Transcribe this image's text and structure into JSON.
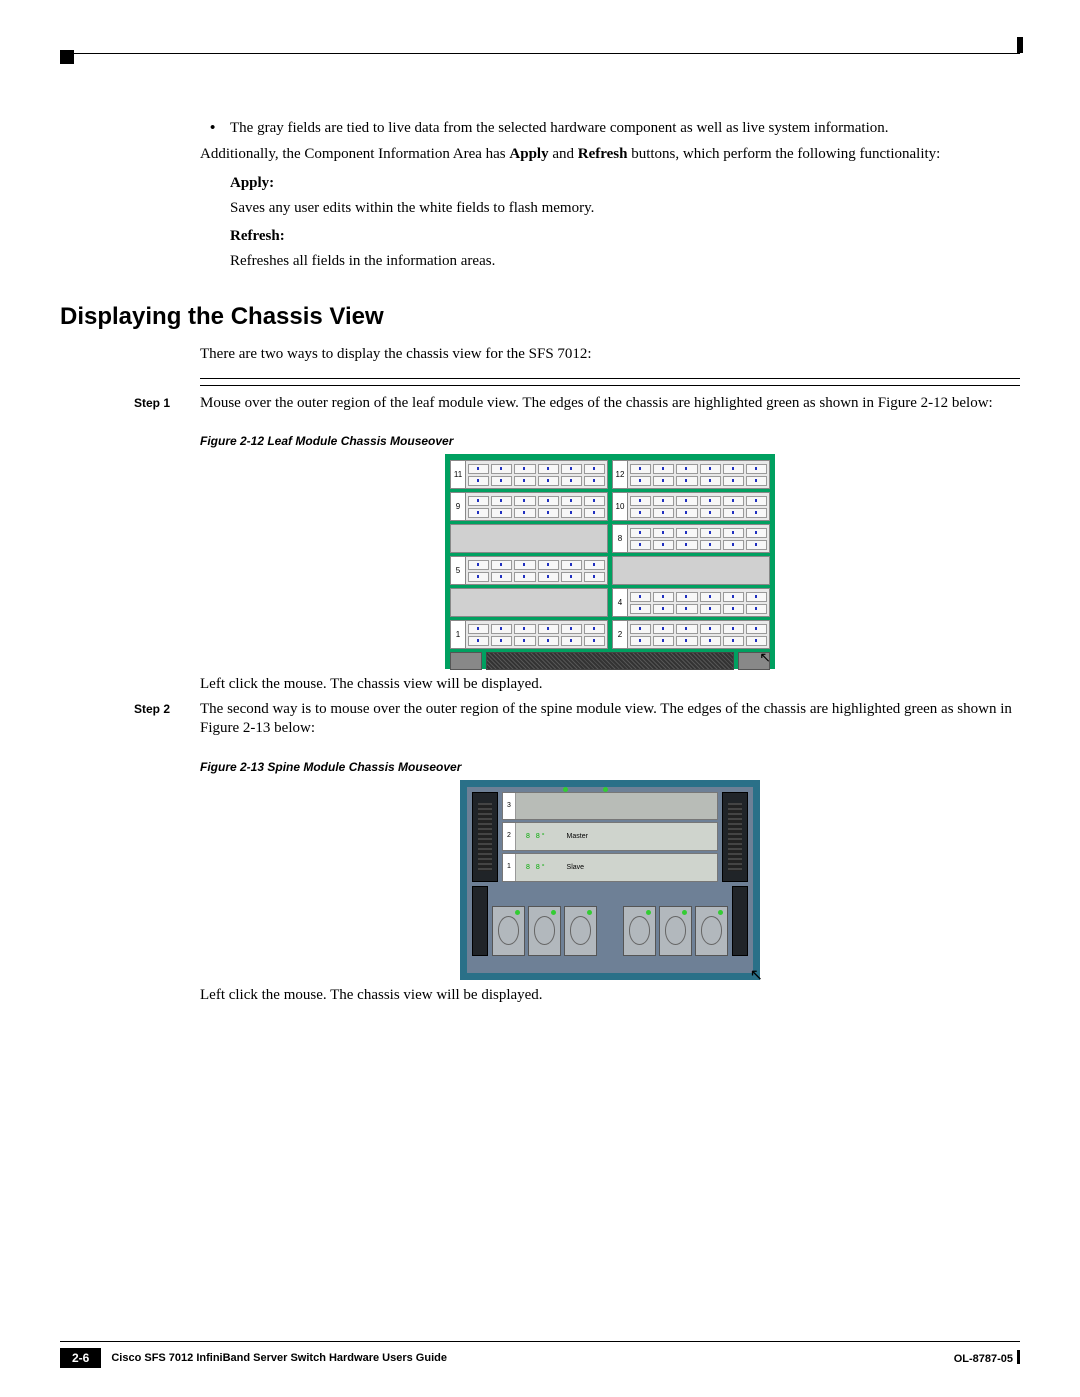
{
  "bullet1": "The gray fields are tied to live data from the selected hardware component as well as live system information.",
  "para_additional_a": "Additionally, the Component Information Area has ",
  "apply_bold_inline": "Apply",
  "and_word": " and ",
  "refresh_bold_inline": "Refresh",
  "para_additional_b": " buttons, which perform the following functionality:",
  "apply_label": "Apply:",
  "apply_text": "Saves any user edits within the white fields to flash memory.",
  "refresh_label": "Refresh:",
  "refresh_text": "Refreshes all fields in the information areas.",
  "section_title": "Displaying the Chassis View",
  "intro_text": "There are two ways to display the chassis view for the SFS 7012:",
  "step1_label": "Step 1",
  "step1_text": "Mouse over the outer region of the leaf module view. The edges of the chassis are highlighted green as shown in Figure 2-12 below:",
  "fig12_caption": "Figure 2-12    Leaf Module Chassis Mouseover",
  "leaf_slots": [
    {
      "left": "11",
      "right": "12"
    },
    {
      "left": "9",
      "right": "10"
    },
    {
      "left_blank": true,
      "right": "8"
    },
    {
      "left": "5",
      "right_blank": true
    },
    {
      "left_blank": true,
      "right": "4"
    },
    {
      "left": "1",
      "right": "2"
    }
  ],
  "step1_post": "Left click the mouse. The chassis view will be displayed.",
  "step2_label": "Step 2",
  "step2_text": "The second way is to mouse over the outer region of the spine module view. The edges of the chassis are highlighted green as shown in Figure 2-13 below:",
  "fig13_caption": "Figure 2-13    Spine Module Chassis Mouseover",
  "spine_slots": [
    {
      "n": "3",
      "empty": true
    },
    {
      "n": "2",
      "label": "Master"
    },
    {
      "n": "1",
      "label": "Slave"
    }
  ],
  "step2_post": "Left click the mouse. The chassis view will be displayed.",
  "footer_title": "Cisco SFS 7012 InfiniBand Server Switch Hardware Users Guide",
  "footer_page": "2-6",
  "footer_docid": "OL-8787-05"
}
